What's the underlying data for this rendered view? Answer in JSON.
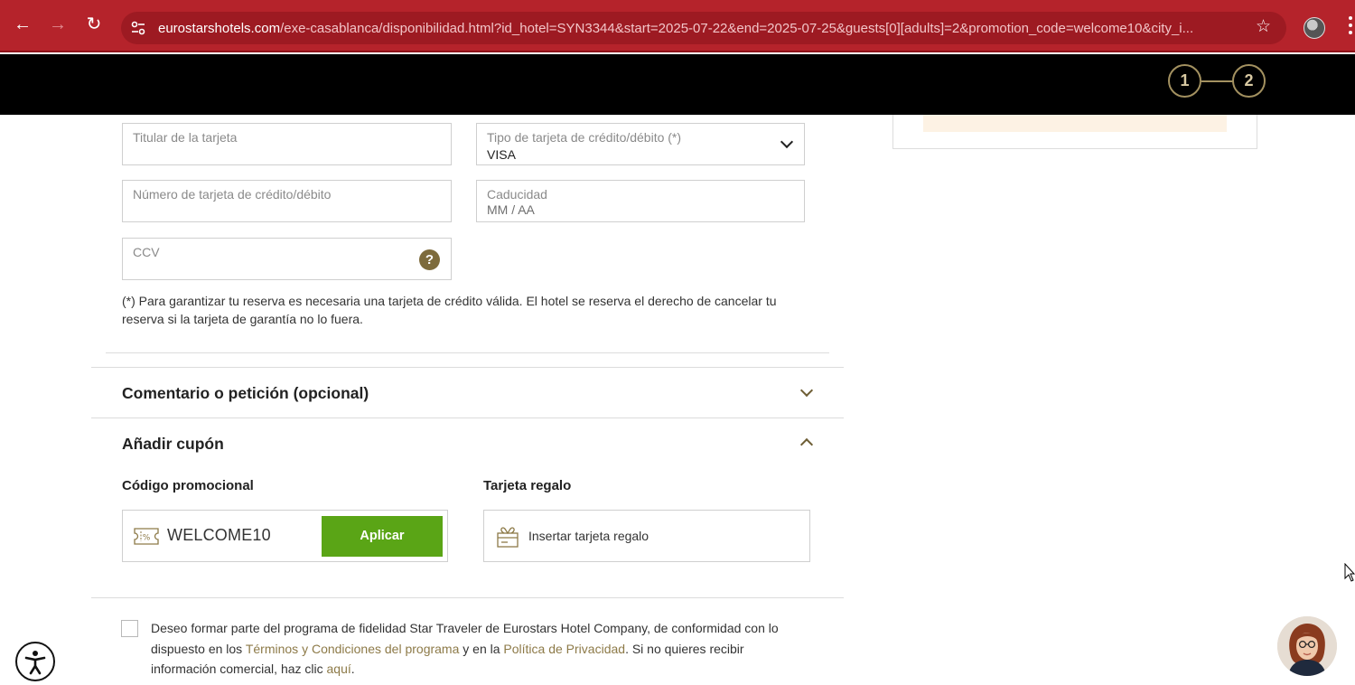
{
  "browser": {
    "url_domain": "eurostarshotels.com",
    "url_path": "/exe-casablanca/disponibilidad.html?id_hotel=SYN3344&start=2025-07-22&end=2025-07-25&guests[0][adults]=2&promotion_code=welcome10&city_i...",
    "back_glyph": "←",
    "forward_glyph": "→",
    "reload_glyph": "↻",
    "star_glyph": "☆"
  },
  "header": {
    "steps": [
      "1",
      "2"
    ]
  },
  "payment": {
    "cardholder_label": "Titular de la tarjeta",
    "card_type_label": "Tipo de tarjeta de crédito/débito (*)",
    "card_type_value": "VISA",
    "card_number_label": "Número de tarjeta de crédito/débito",
    "expiry_label": "Caducidad",
    "expiry_placeholder": "MM / AA",
    "ccv_label": "CCV",
    "ccv_help_glyph": "?",
    "notice": "(*) Para garantizar tu reserva es necesaria una tarjeta de crédito válida. El hotel se reserva el derecho de cancelar tu reserva si la tarjeta de garantía no lo fuera."
  },
  "comment_section": {
    "title": "Comentario o petición (opcional)"
  },
  "coupon_section": {
    "title": "Añadir cupón",
    "promo_label": "Código promocional",
    "promo_value": "WELCOME10",
    "apply_label": "Aplicar",
    "gift_label": "Tarjeta regalo",
    "gift_placeholder": "Insertar tarjeta regalo"
  },
  "loyalty": {
    "text_1": "Deseo formar parte del programa de fidelidad Star Traveler de Eurostars Hotel Company, de conformidad con lo dispuesto en los ",
    "terms_link": "Términos y Condiciones del programa",
    "text_2": " y en la ",
    "privacy_link": "Política de Privacidad",
    "text_3": ". Si no quieres recibir información comercial, haz clic ",
    "here_link": "aquí",
    "text_4": "."
  },
  "colors": {
    "browser_bar": "#b5232b",
    "accent_olive": "#7d6b3c",
    "apply_green": "#5aa516"
  }
}
